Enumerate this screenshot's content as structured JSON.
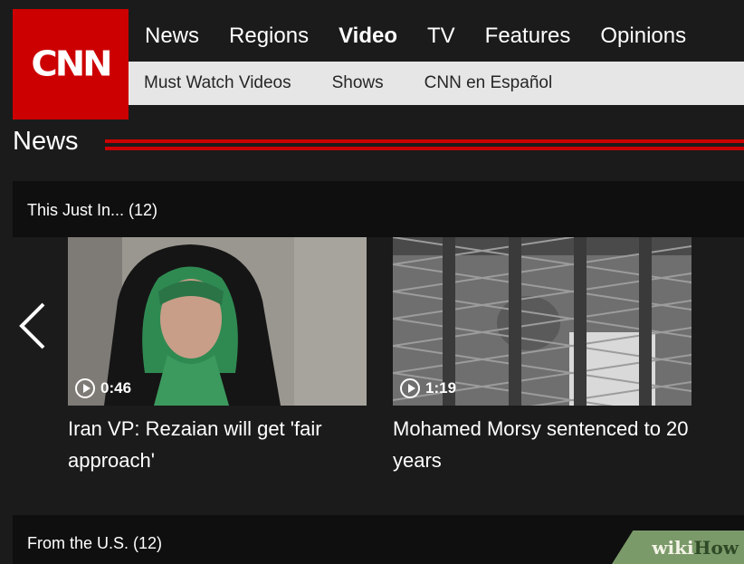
{
  "brand": {
    "logo_text": "CNN",
    "accent": "#cc0000"
  },
  "main_nav": [
    "News",
    "Regions",
    "Video",
    "TV",
    "Features",
    "Opinions"
  ],
  "main_nav_active": "Video",
  "sub_nav": [
    "Must Watch Videos",
    "Shows",
    "CNN en Español"
  ],
  "section": {
    "title": "News"
  },
  "carousel_1": {
    "label": "This Just In... (12)",
    "prev_icon": "chevron-left-icon",
    "items": [
      {
        "duration": "0:46",
        "headline": "Iran VP: Rezaian will get 'fair approach'"
      },
      {
        "duration": "1:19",
        "headline": "Mohamed Morsy sentenced to 20 years"
      }
    ]
  },
  "carousel_2": {
    "label": "From the U.S. (12)"
  },
  "watermark": {
    "part_a": "wiki",
    "part_b": "How"
  }
}
